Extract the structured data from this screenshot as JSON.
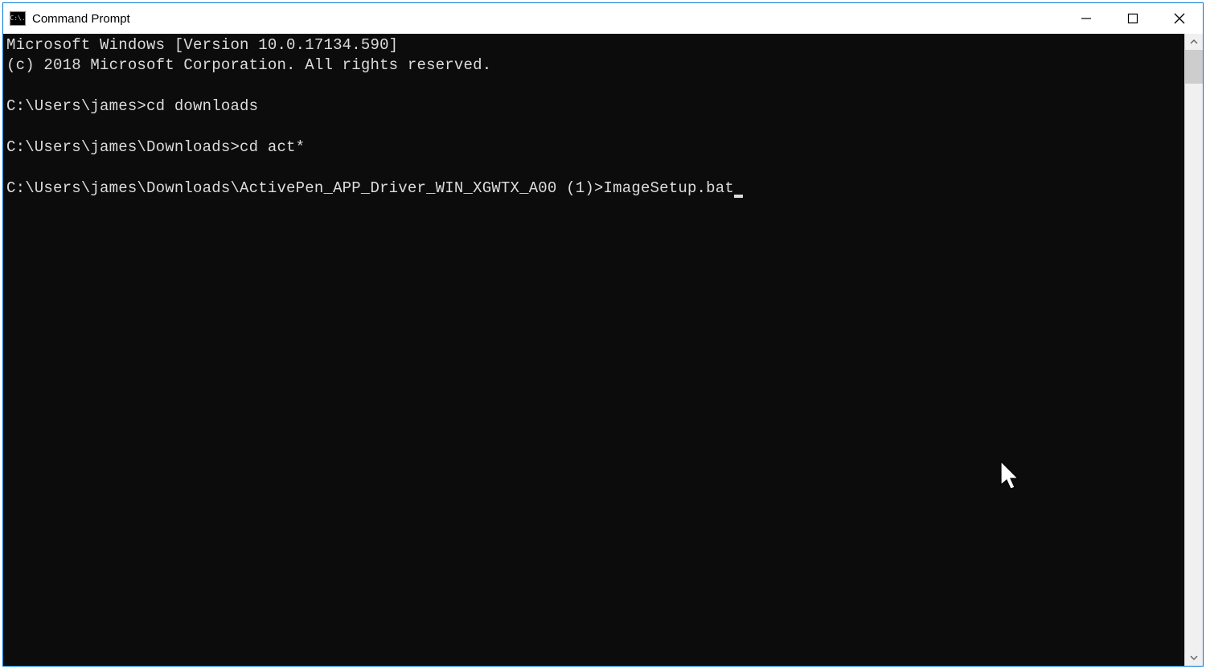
{
  "window": {
    "title": "Command Prompt"
  },
  "terminal": {
    "lines": [
      "Microsoft Windows [Version 10.0.17134.590]",
      "(c) 2018 Microsoft Corporation. All rights reserved.",
      "",
      "C:\\Users\\james>cd downloads",
      "",
      "C:\\Users\\james\\Downloads>cd act*",
      ""
    ],
    "current_prompt": "C:\\Users\\james\\Downloads\\ActivePen_APP_Driver_WIN_XGWTX_A00 (1)>",
    "current_input": "ImageSetup.bat"
  }
}
